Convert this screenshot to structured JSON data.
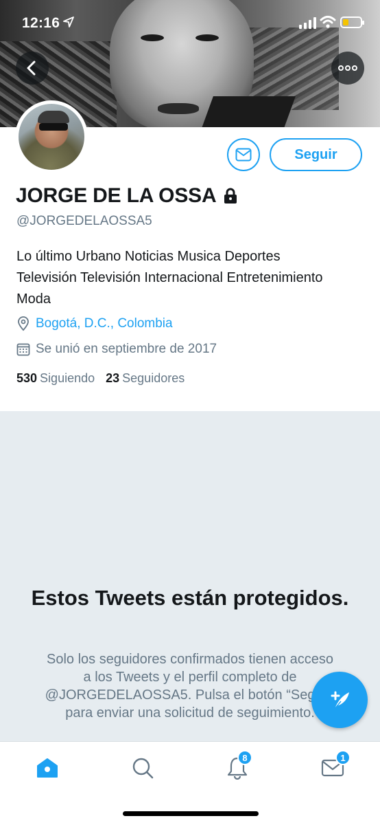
{
  "status_bar": {
    "time": "12:16"
  },
  "header": {
    "back_icon": "chevron-left-icon",
    "more_icon": "ellipsis-icon"
  },
  "profile": {
    "name": "JORGE DE LA OSSA",
    "handle": "@JORGEDELAOSSA5",
    "bio": "Lo último Urbano Noticias Musica Deportes Televisión Televisión Internacional Entretenimiento Moda",
    "location": "Bogotá, D.C., Colombia",
    "joined": "Se unió en septiembre de 2017",
    "following_count": "530",
    "following_label": "Siguiendo",
    "followers_count": "23",
    "followers_label": "Seguidores"
  },
  "actions": {
    "follow_label": "Seguir"
  },
  "protected": {
    "title": "Estos Tweets están protegidos.",
    "body": "Solo los seguidores confirmados tienen acceso a los Tweets y el perfil completo de @JORGEDELAOSSA5. Pulsa el botón “Seguir” para enviar una solicitud de seguimiento."
  },
  "tabbar": {
    "notifications_badge": "8",
    "messages_badge": "1"
  },
  "colors": {
    "accent": "#1da1f2",
    "secondary_text": "#657786",
    "protected_bg": "#e6ecf0"
  }
}
